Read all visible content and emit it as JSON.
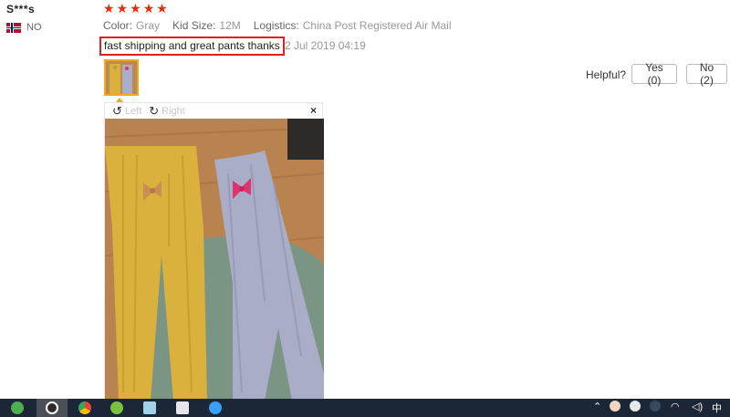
{
  "reviewer": {
    "name": "S***s",
    "country_code": "NO"
  },
  "rating": {
    "stars": 5,
    "max": 5,
    "star_color": "#e62e04"
  },
  "attributes": [
    {
      "key": "Color:",
      "value": "Gray"
    },
    {
      "key": "Kid Size:",
      "value": "12M"
    },
    {
      "key": "Logistics:",
      "value": "China Post Registered Air Mail"
    }
  ],
  "feedback": {
    "text": "fast shipping and great pants thanks",
    "date": "2 Jul 2019 04:19"
  },
  "helpful": {
    "label": "Helpful?",
    "yes": "Yes (0)",
    "no": "No (2)"
  },
  "viewer": {
    "rotate_left": "Left",
    "rotate_right": "Right",
    "close": "×"
  },
  "taskbar": {
    "input_method": "中",
    "icons": [
      "ie-icon",
      "music-icon",
      "chrome-icon",
      "wechat-icon",
      "notes-icon",
      "photos-icon",
      "browser-icon"
    ]
  },
  "colors": {
    "highlight_border": "#e02020",
    "thumb_border": "#f5a623",
    "taskbar": "#1b2637"
  }
}
